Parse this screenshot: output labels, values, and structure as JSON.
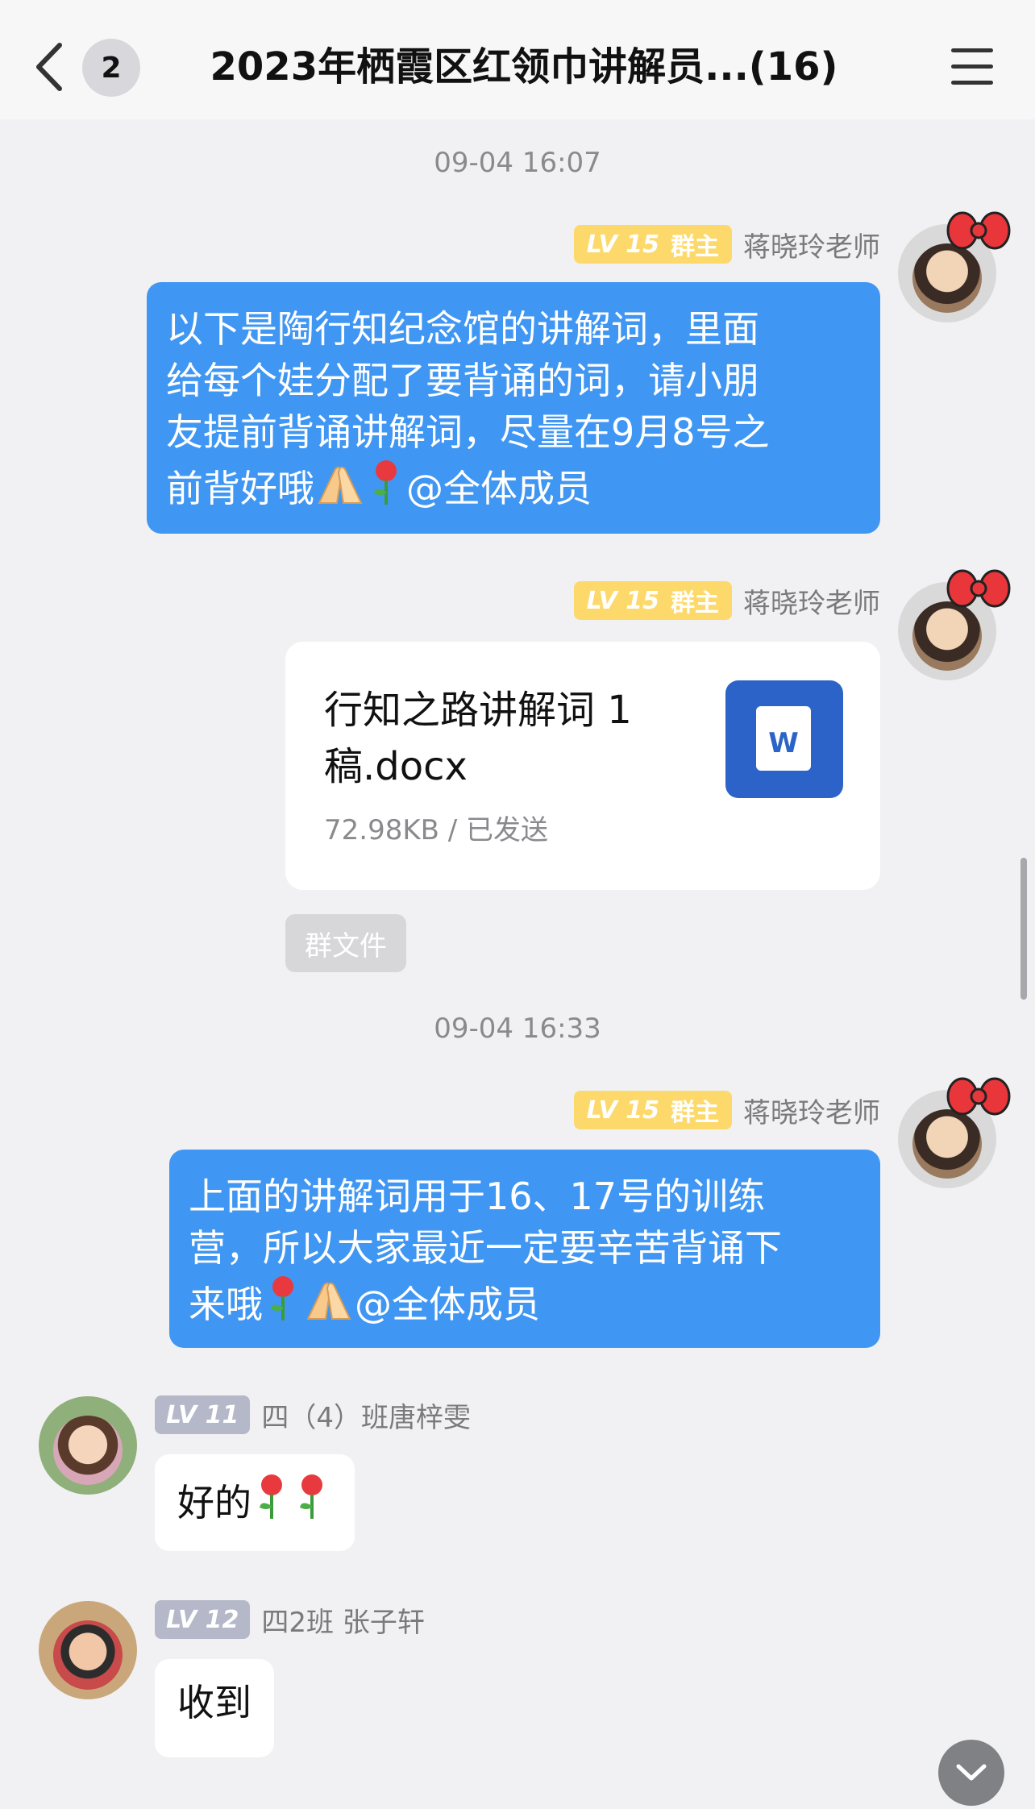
{
  "header": {
    "unread_count": "2",
    "title": "2023年栖霞区红领巾讲解员...(16)"
  },
  "messages": {
    "time1": "09-04 16:07",
    "msg1": {
      "level": "LV 15",
      "role": "群主",
      "sender": "蒋晓玲老师",
      "text_line1": "以下是陶行知纪念馆的讲解词，里面",
      "text_line2": "给每个娃分配了要背诵的词，请小朋",
      "text_line3": "友提前背诵讲解词，尽量在9月8号之",
      "text_line4_prefix": "前背好哦",
      "text_line4_suffix": "@全体成员"
    },
    "msg2": {
      "level": "LV 15",
      "role": "群主",
      "sender": "蒋晓玲老师",
      "file_name_line1": "行知之路讲解词 1",
      "file_name_line2": "稿.docx",
      "file_meta": "72.98KB / 已发送",
      "file_icon_letter": "W",
      "group_file_label": "群文件"
    },
    "time2": "09-04 16:33",
    "msg3": {
      "level": "LV 15",
      "role": "群主",
      "sender": "蒋晓玲老师",
      "text_line1": "上面的讲解词用于16、17号的训练",
      "text_line2": "营，所以大家最近一定要辛苦背诵下",
      "text_line3_prefix": "来哦",
      "text_line3_suffix": "@全体成员"
    },
    "msg4": {
      "level": "LV 11",
      "sender": "四（4）班唐梓雯",
      "text": "好的"
    },
    "msg5": {
      "level": "LV 12",
      "sender": "四2班 张子轩",
      "text": "收到"
    }
  },
  "colors": {
    "bubble_blue": "#4096f3",
    "owner_badge": "#fcd96a",
    "member_badge": "#b4b8c8",
    "doc_icon_blue": "#2b63c8"
  }
}
